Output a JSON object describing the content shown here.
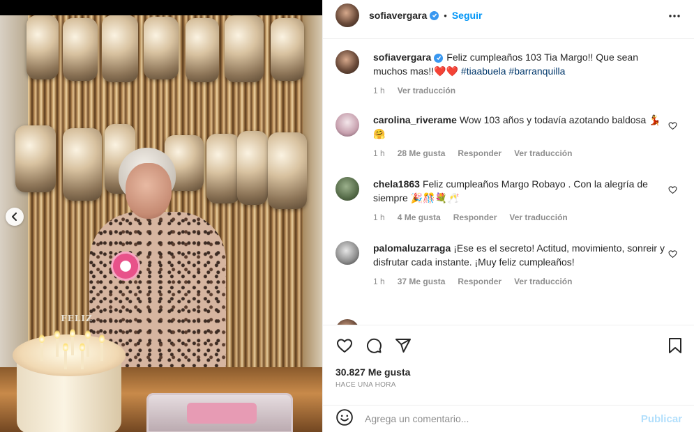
{
  "post": {
    "image_alt_text": "",
    "carousel_prev_icon": "chevron-left-icon",
    "cake_topper_text": "FELIZ"
  },
  "header": {
    "username": "sofiavergara",
    "separator": "•",
    "follow_label": "Seguir",
    "more_icon": "more-horizontal-icon"
  },
  "caption": {
    "username": "sofiavergara",
    "text": "Feliz cumpleaños 103 Tia Margo!! Que sean muchos mas!!",
    "emoji": "❤️❤️",
    "hashtags": "#tiaabuela #barranquilla",
    "time": "1 h",
    "translate": "Ver traducción"
  },
  "comments": [
    {
      "username": "carolina_riverame",
      "text": "Wow 103 años y todavía azotando baldosa 💃🤗",
      "time": "1 h",
      "likes": "28 Me gusta",
      "reply": "Responder",
      "translate": "Ver traducción"
    },
    {
      "username": "chela1863",
      "text": "Feliz cumpleaños Margo Robayo . Con la alegría de siempre 🎉🎊💐🥂",
      "time": "1 h",
      "likes": "4 Me gusta",
      "reply": "Responder",
      "translate": "Ver traducción"
    },
    {
      "username": "palomaluzarraga",
      "text": "¡Ese es el secreto! Actitud, movimiento, sonreir y disfrutar cada instante. ¡Muy feliz cumpleaños!",
      "time": "1 h",
      "likes": "37 Me gusta",
      "reply": "Responder",
      "translate": "Ver traducción"
    }
  ],
  "actions": {
    "like_icon": "heart-icon",
    "comment_icon": "comment-icon",
    "share_icon": "send-icon",
    "save_icon": "bookmark-icon"
  },
  "stats": {
    "likes": "30.827 Me gusta",
    "posted": "HACE UNA HORA"
  },
  "composer": {
    "emoji_icon": "smile-icon",
    "placeholder": "Agrega un comentario...",
    "publish_label": "Publicar"
  },
  "colors": {
    "accent": "#0095f6",
    "link": "#00376b",
    "muted": "#8e8e8e",
    "publish_disabled": "#b2dffc",
    "verified": "#3897f0"
  }
}
